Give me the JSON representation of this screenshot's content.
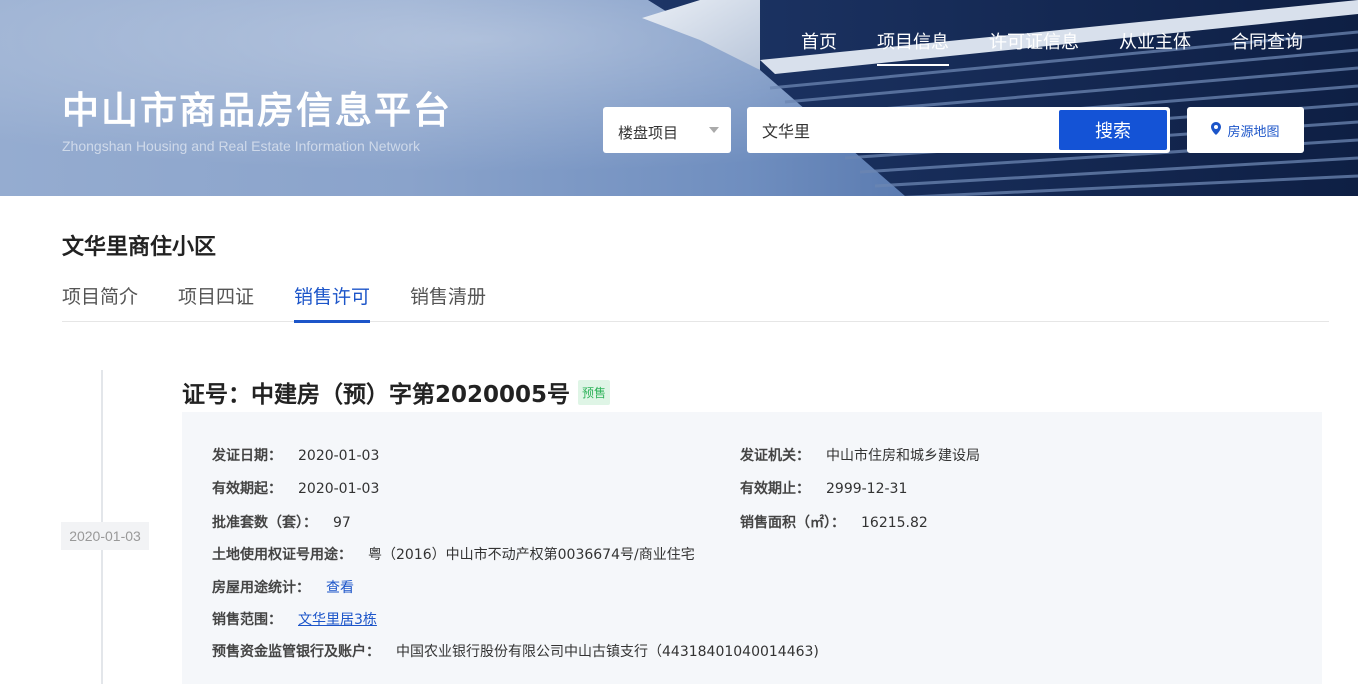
{
  "header": {
    "title": "中山市商品房信息平台",
    "subtitle": "Zhongshan Housing and Real Estate Information Network",
    "nav": [
      "首页",
      "项目信息",
      "许可证信息",
      "从业主体",
      "合同查询"
    ],
    "active_nav": "项目信息"
  },
  "search": {
    "category": "楼盘项目",
    "value": "文华里",
    "button": "搜索",
    "map_button": "房源地图"
  },
  "project": {
    "name": "文华里商住小区",
    "tabs": [
      "项目简介",
      "项目四证",
      "销售许可",
      "销售清册"
    ],
    "active_tab": "销售许可"
  },
  "permit": {
    "date": "2020-01-03",
    "title": "证号：中建房（预）字第2020005号",
    "badge": "预售",
    "issue_date_label": "发证日期：",
    "issue_date": "2020-01-03",
    "issuer_label": "发证机关：",
    "issuer": "中山市住房和城乡建设局",
    "valid_from_label": "有效期起：",
    "valid_from": "2020-01-03",
    "valid_to_label": "有效期止：",
    "valid_to": "2999-12-31",
    "units_label": "批准套数（套）：",
    "units": "97",
    "area_label": "销售面积（㎡）：",
    "area": "16215.82",
    "land_label": "土地使用权证号用途：",
    "land": "粤（2016）中山市不动产权第0036674号/商业住宅",
    "usage_stats_label": "房屋用途统计：",
    "usage_stats_link": "查看",
    "sales_scope_label": "销售范围：",
    "sales_scope": "文华里居3栋",
    "bank_label": "预售资金监管银行及账户：",
    "bank": "中国农业银行股份有限公司中山古镇支行（44318401040014463)"
  }
}
